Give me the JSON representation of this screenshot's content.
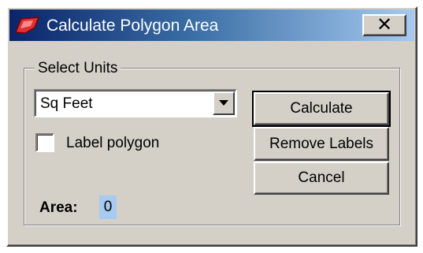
{
  "window": {
    "title": "Calculate Polygon Area",
    "close_label": "✕"
  },
  "units_group": {
    "label": "Select Units",
    "selected_unit": "Sq Feet"
  },
  "label_polygon": {
    "label": "Label polygon",
    "checked": false
  },
  "area": {
    "label": "Area:",
    "value": "0"
  },
  "buttons": {
    "calculate": "Calculate",
    "remove_labels": "Remove Labels",
    "cancel": "Cancel"
  },
  "icons": {
    "app": "polygon-icon",
    "close": "close-icon",
    "dropdown": "chevron-down-icon"
  },
  "colors": {
    "titlebar_start": "#0a246a",
    "titlebar_end": "#a6caf0",
    "dialog_face": "#d4d0c8",
    "area_highlight": "#a6caf0",
    "icon_red": "#e03030"
  }
}
